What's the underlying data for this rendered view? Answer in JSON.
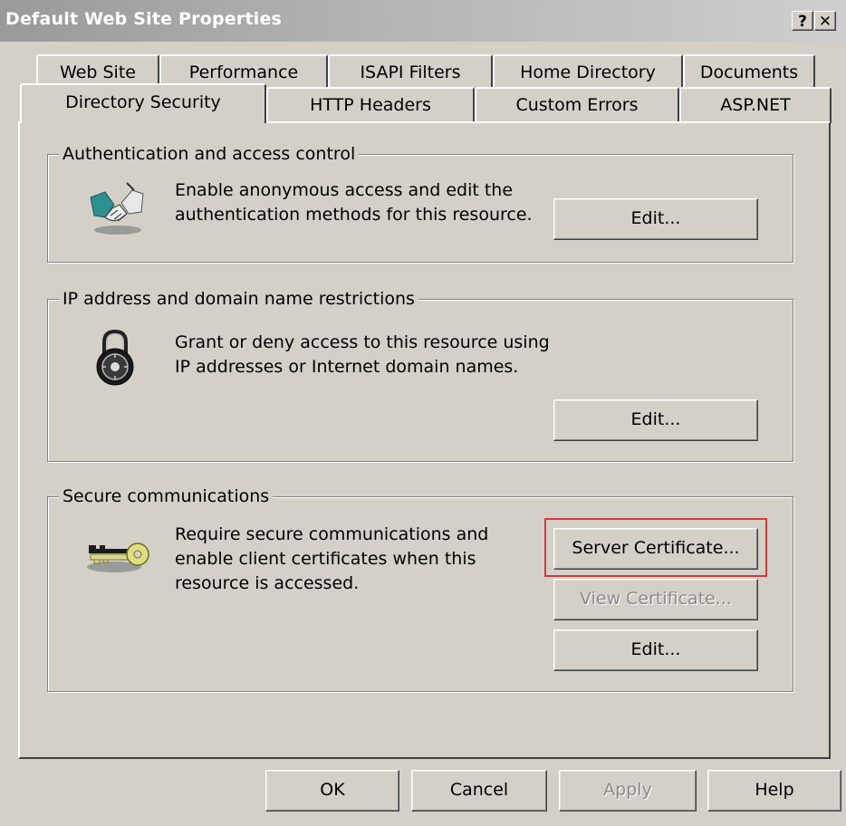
{
  "window": {
    "title": "Default Web Site Properties",
    "help_button": "?",
    "close_button": "✕"
  },
  "tabs": {
    "row1": [
      "Web Site",
      "Performance",
      "ISAPI Filters",
      "Home Directory",
      "Documents"
    ],
    "row2": [
      "Directory Security",
      "HTTP Headers",
      "Custom Errors",
      "ASP.NET"
    ],
    "selected": "Directory Security"
  },
  "groups": {
    "auth": {
      "title": "Authentication and access control",
      "description_line1": "Enable anonymous access and edit the",
      "description_line2": "authentication methods for this resource.",
      "edit_label": "Edit...",
      "icon": "handshake-icon"
    },
    "ip": {
      "title": "IP address and domain name restrictions",
      "description_line1": "Grant or deny access to this resource using",
      "description_line2": "IP addresses or Internet domain names.",
      "edit_label": "Edit...",
      "icon": "padlock-icon"
    },
    "secure": {
      "title": "Secure communications",
      "description_line1": "Require secure communications and",
      "description_line2": "enable client certificates when this",
      "description_line3": "resource is accessed.",
      "server_cert_label": "Server Certificate...",
      "view_cert_label": "View Certificate...",
      "edit_label": "Edit...",
      "icon": "keys-icon"
    }
  },
  "footer": {
    "ok_label": "OK",
    "cancel_label": "Cancel",
    "apply_label": "Apply",
    "help_label": "Help"
  },
  "colors": {
    "face": "#d4d0c8",
    "highlight_box": "#d33a3a",
    "disabled_text": "#8a8a8a"
  }
}
